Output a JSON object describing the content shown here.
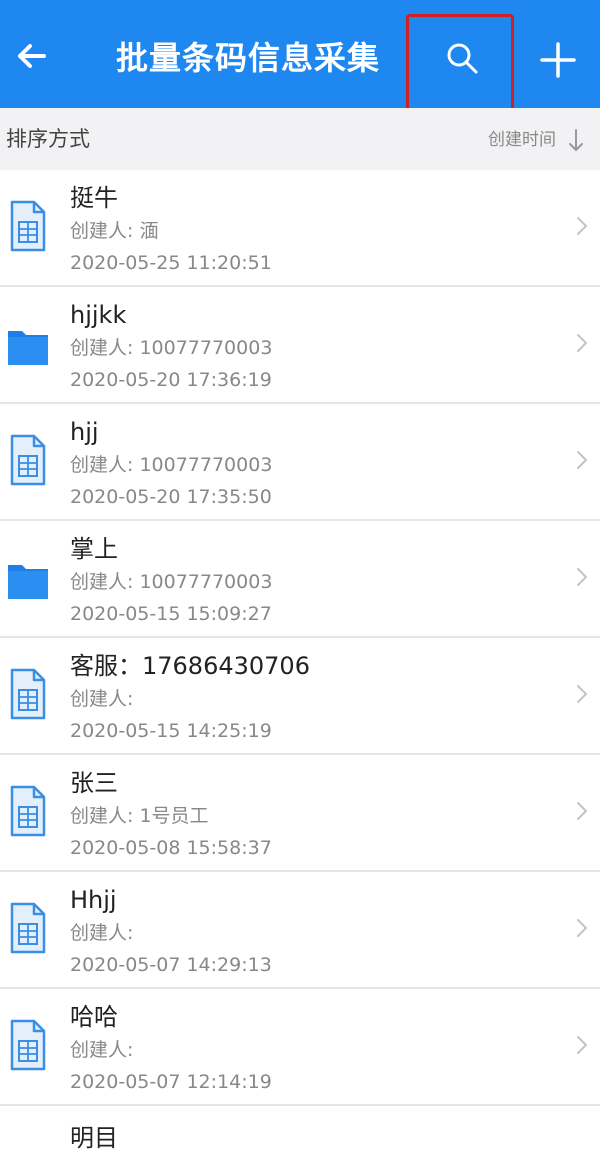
{
  "header": {
    "title": "批量条码信息采集",
    "back_icon": "arrow-left-icon",
    "search_icon": "search-icon",
    "add_icon": "plus-icon"
  },
  "sort": {
    "label": "排序方式",
    "value": "创建时间",
    "direction_icon": "arrow-down-icon"
  },
  "items": [
    {
      "type": "file-icon",
      "name": "挺牛",
      "creator": "创建人: 湎",
      "time": "2020-05-25 11:20:51"
    },
    {
      "type": "folder-icon",
      "name": "hjjkk",
      "creator": "创建人: 10077770003",
      "time": "2020-05-20 17:36:19"
    },
    {
      "type": "file-icon",
      "name": "hjj",
      "creator": "创建人: 10077770003",
      "time": "2020-05-20 17:35:50"
    },
    {
      "type": "folder-icon",
      "name": "掌上",
      "creator": "创建人: 10077770003",
      "time": "2020-05-15 15:09:27"
    },
    {
      "type": "file-icon",
      "name": "客服：17686430706",
      "creator": "创建人:",
      "time": "2020-05-15 14:25:19"
    },
    {
      "type": "file-icon",
      "name": "张三",
      "creator": "创建人: 1号员工",
      "time": "2020-05-08 15:58:37"
    },
    {
      "type": "file-icon",
      "name": "Hhjj",
      "creator": "创建人:",
      "time": "2020-05-07 14:29:13"
    },
    {
      "type": "file-icon",
      "name": "哈哈",
      "creator": "创建人:",
      "time": "2020-05-07 12:14:19"
    }
  ],
  "partial_item": {
    "name": "明目"
  },
  "colors": {
    "primary": "#1e88f0",
    "highlight": "#cc2222",
    "secondary_text": "#888888"
  }
}
